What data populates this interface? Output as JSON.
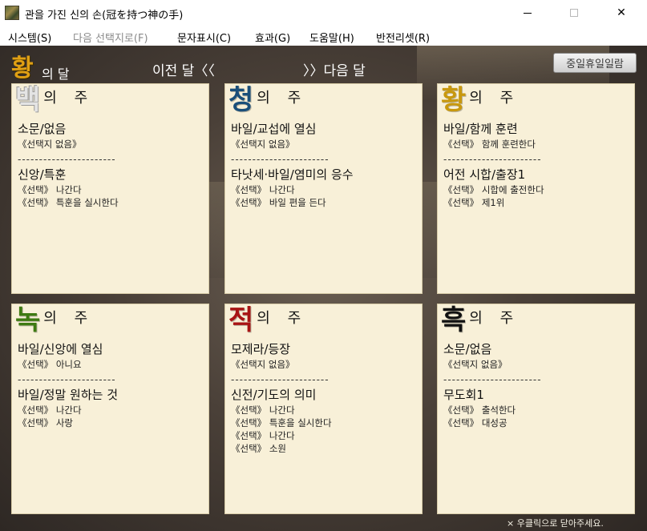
{
  "window": {
    "title": "관을 가진 신의 손(冠を持つ神の手)",
    "minimize_glyph": "",
    "close_glyph": "✕"
  },
  "menu": [
    {
      "label": "시스템(S)",
      "enabled": true
    },
    {
      "label": "다음 선택지로(F)",
      "enabled": false
    },
    {
      "label": "문자표시(C)",
      "enabled": true
    },
    {
      "label": "효과(G)",
      "enabled": true
    },
    {
      "label": "도움말(H)",
      "enabled": true
    },
    {
      "label": "반전리셋(R)",
      "enabled": true
    }
  ],
  "header": {
    "month_char": "황",
    "month_suffix": "의 달",
    "prev_label": "이전 달〈〈",
    "next_label": "〉〉다음 달",
    "holiday_button": "중일휴일일람"
  },
  "weeks": [
    {
      "char": "백",
      "suffix": "의 주",
      "color": "#e4e4e4",
      "entries": [
        {
          "title": "소문/없음",
          "choices": [
            "《선택지 없음》"
          ]
        },
        {
          "title": "신앙/특훈",
          "choices": [
            "《선택》 나간다",
            "《선택》 특훈을 실시한다"
          ]
        }
      ]
    },
    {
      "char": "청",
      "suffix": "의 주",
      "color": "#1a4f7a",
      "entries": [
        {
          "title": "바일/교섭에 열심",
          "choices": [
            "《선택지 없음》"
          ]
        },
        {
          "title": "타낫세·바일/염미의 응수",
          "choices": [
            "《선택》 나간다",
            "《선택》 바일 편을 든다"
          ]
        }
      ]
    },
    {
      "char": "황",
      "suffix": "의 주",
      "color": "#c8980e",
      "entries": [
        {
          "title": "바일/함께 훈련",
          "choices": [
            "《선택》 함께 훈련한다"
          ]
        },
        {
          "title": "어전 시합/출장1",
          "choices": [
            "《선택》 시합에 출전한다",
            "《선택》 제1위"
          ]
        }
      ]
    },
    {
      "char": "녹",
      "suffix": "의 주",
      "color": "#3e7a12",
      "entries": [
        {
          "title": "바일/신앙에 열심",
          "choices": [
            "《선택》 아니요"
          ]
        },
        {
          "title": "바일/정말 원하는 것",
          "choices": [
            "《선택》 나간다",
            "《선택》 사랑"
          ]
        }
      ]
    },
    {
      "char": "적",
      "suffix": "의 주",
      "color": "#a81414",
      "entries": [
        {
          "title": "모제라/등장",
          "choices": [
            "《선택지 없음》"
          ]
        },
        {
          "title": "신전/기도의 의미",
          "choices": [
            "《선택》 나간다",
            "《선택》 특훈을 실시한다",
            "《선택》 나간다",
            "《선택》 소원"
          ]
        }
      ]
    },
    {
      "char": "흑",
      "suffix": "의 주",
      "color": "#111111",
      "entries": [
        {
          "title": "소문/없음",
          "choices": [
            "《선택지 없음》"
          ]
        },
        {
          "title": "무도회1",
          "choices": [
            "《선택》 출석한다",
            "《선택》 대성공"
          ]
        }
      ]
    }
  ],
  "divider_text": "-----------------------",
  "footer_note": "× 우클릭으로 닫아주세요."
}
